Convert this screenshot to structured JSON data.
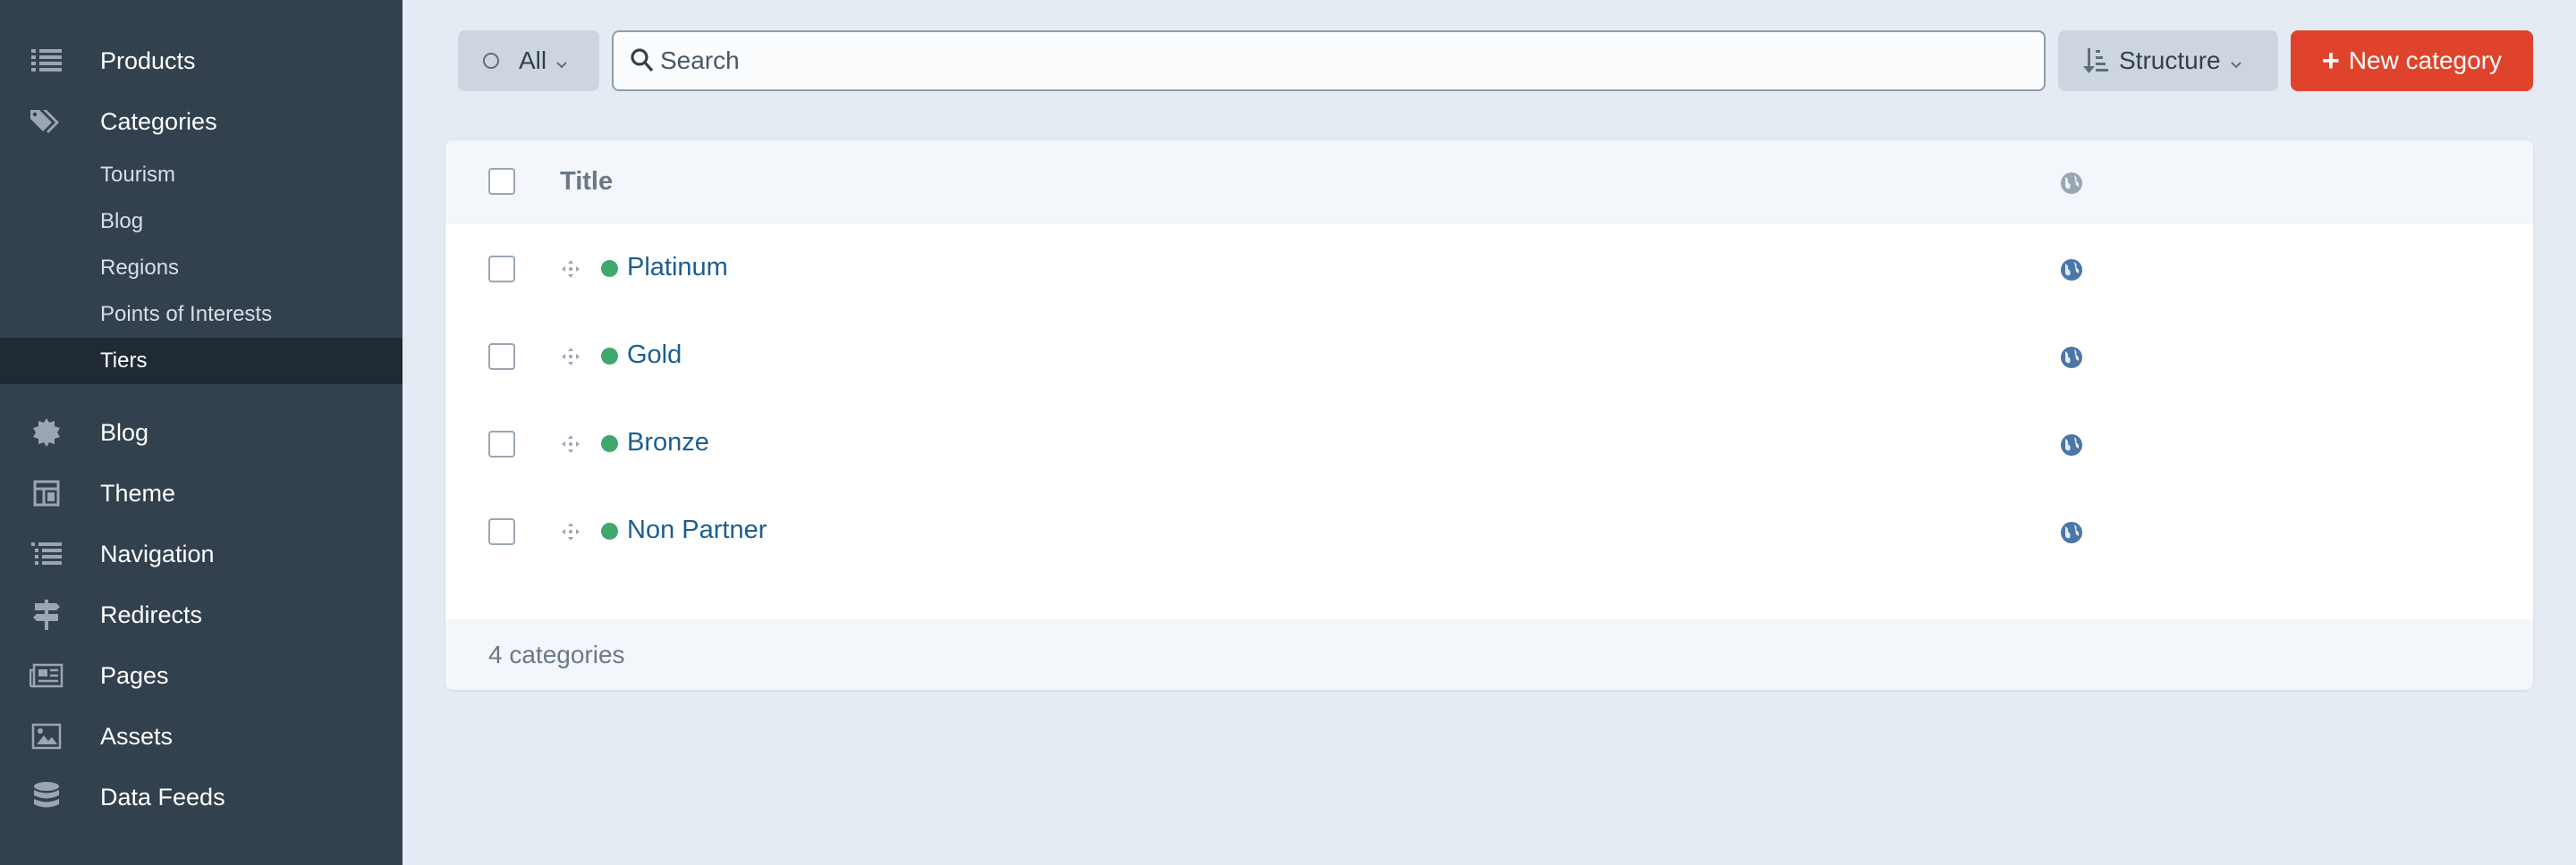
{
  "sidebar": {
    "items": [
      {
        "label": "Products",
        "icon": "list-icon"
      },
      {
        "label": "Categories",
        "icon": "tags-icon",
        "children": [
          {
            "label": "Tourism"
          },
          {
            "label": "Blog"
          },
          {
            "label": "Regions"
          },
          {
            "label": "Points of Interests"
          },
          {
            "label": "Tiers",
            "active": true
          }
        ]
      },
      {
        "label": "Blog",
        "icon": "badge-icon"
      },
      {
        "label": "Theme",
        "icon": "layout-icon"
      },
      {
        "label": "Navigation",
        "icon": "nav-list-icon"
      },
      {
        "label": "Redirects",
        "icon": "signpost-icon"
      },
      {
        "label": "Pages",
        "icon": "newspaper-icon"
      },
      {
        "label": "Assets",
        "icon": "image-icon"
      },
      {
        "label": "Data Feeds",
        "icon": "database-icon"
      }
    ]
  },
  "toolbar": {
    "status_filter": "All",
    "search_placeholder": "Search",
    "search_value": "",
    "sort_label": "Structure",
    "new_button": "New category"
  },
  "table": {
    "header_title": "Title",
    "rows": [
      {
        "title": "Platinum",
        "status": "enabled"
      },
      {
        "title": "Gold",
        "status": "enabled"
      },
      {
        "title": "Bronze",
        "status": "enabled"
      },
      {
        "title": "Non Partner",
        "status": "enabled"
      }
    ],
    "footer_count": "4 categories"
  },
  "colors": {
    "sidebar_bg": "#33404d",
    "active_bg": "#1f2a35",
    "accent_red": "#e0432c",
    "link_blue": "#1c5e8f",
    "status_green": "#41a86d"
  }
}
